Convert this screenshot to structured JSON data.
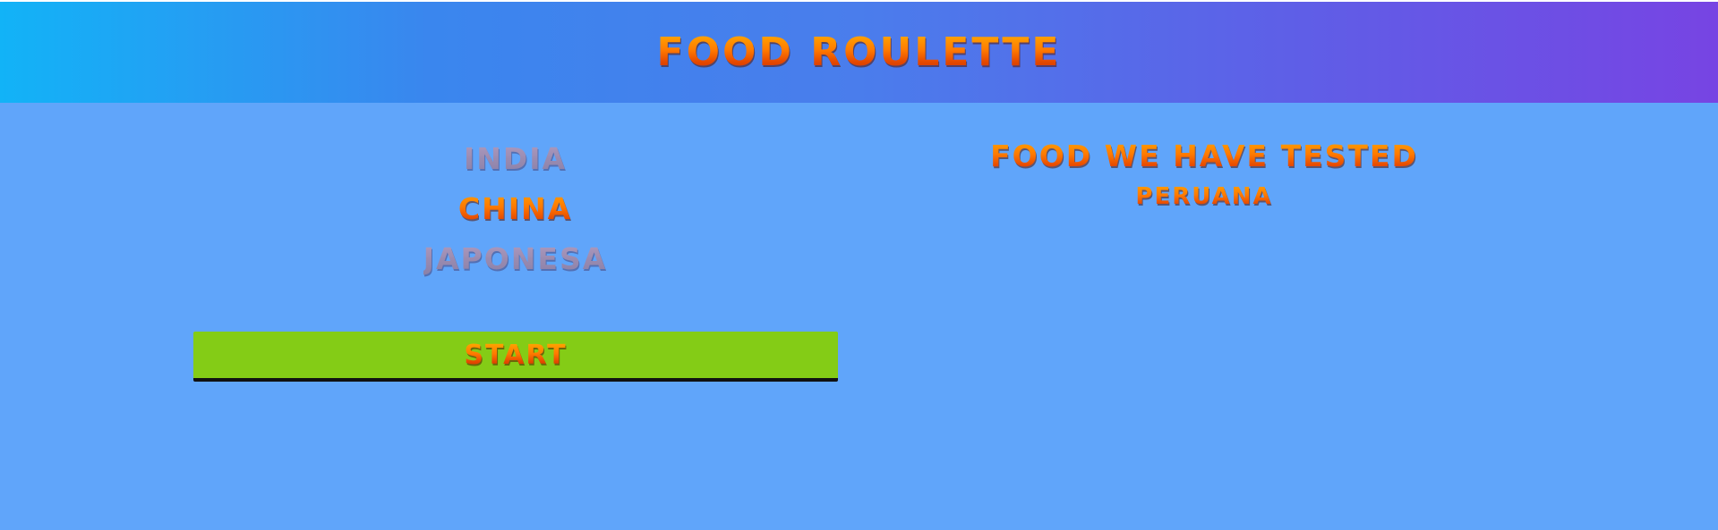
{
  "header": {
    "title": "FOOD ROULETTE"
  },
  "roulette": {
    "options": [
      {
        "label": "INDIA",
        "state": "inactive"
      },
      {
        "label": "CHINA",
        "state": "active"
      },
      {
        "label": "JAPONESA",
        "state": "inactive"
      }
    ],
    "start_label": "START"
  },
  "tested": {
    "title": "FOOD WE HAVE TESTED",
    "items": [
      "PERUANA"
    ]
  },
  "colors": {
    "background": "#60a5fa",
    "header_gradient_start": "#12b3f7",
    "header_gradient_end": "#7744e3",
    "start_button": "#84cc16",
    "text_orange": "#ff7a00",
    "text_dim": "#9a8bb0"
  }
}
